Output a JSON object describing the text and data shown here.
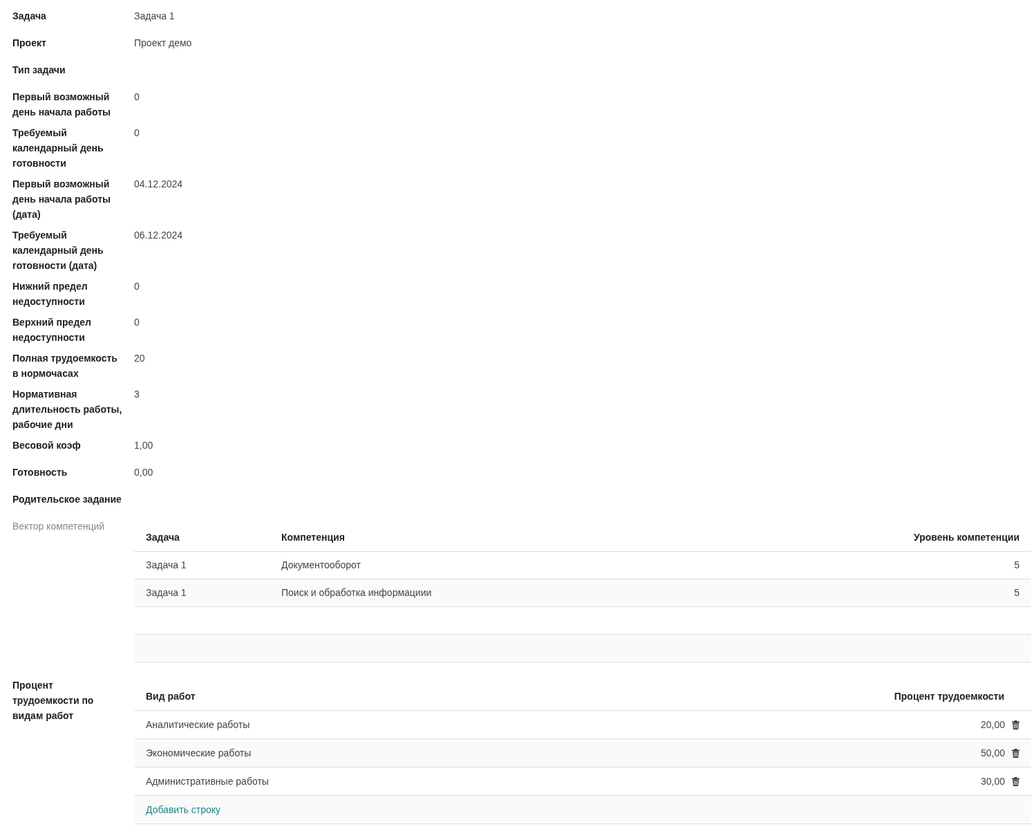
{
  "fields": [
    {
      "label": "Задача",
      "value": "Задача 1"
    },
    {
      "label": "Проект",
      "value": "Проект демо"
    },
    {
      "label": "Тип задачи"
    },
    {
      "label": "Первый возможный день начала работы",
      "value": "0"
    },
    {
      "label": "Требуемый календарный день готовности",
      "value": "0"
    },
    {
      "label": "Первый возможный день начала работы (дата)",
      "value": "04.12.2024"
    },
    {
      "label": "Требуемый календарный день готовности (дата)",
      "value": "06.12.2024"
    },
    {
      "label": "Нижний предел недоступности",
      "value": "0"
    },
    {
      "label": "Верхний предел недоступности",
      "value": "0"
    },
    {
      "label": "Полная трудоемкость в нормочасах",
      "value": "20"
    },
    {
      "label": "Нормативная длительность работы, рабочие дни",
      "value": "3"
    },
    {
      "label": "Весовой коэф",
      "value": "1,00"
    },
    {
      "label": "Готовность",
      "value": "0,00"
    },
    {
      "label": "Родительское задание"
    }
  ],
  "competence_vector": {
    "label": "Вектор компетенций",
    "muted": true,
    "columns": [
      "Задача",
      "Компетенция",
      "Уровень компетенции"
    ],
    "rows": [
      {
        "task": "Задача 1",
        "competence": "Документооборот",
        "level": "5"
      },
      {
        "task": "Задача 1",
        "competence": "Поиск и обработка информациии",
        "level": "5"
      }
    ]
  },
  "work_types": {
    "label": "Процент трудоемкости по видам работ",
    "muted": false,
    "columns": [
      "Вид работ",
      "Процент трудоемкости"
    ],
    "rows": [
      {
        "type": "Аналитические работы",
        "percent": "20,00"
      },
      {
        "type": "Экономические работы",
        "percent": "50,00"
      },
      {
        "type": "Административные работы",
        "percent": "30,00"
      }
    ],
    "add_link": "Добавить строку"
  }
}
